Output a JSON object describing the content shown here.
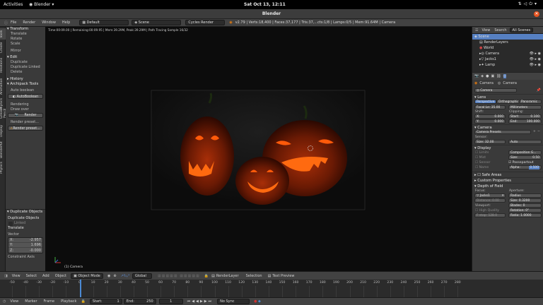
{
  "top_bar": {
    "activities": "Activities",
    "app_name": "Blender",
    "clock": "Sat Oct 13, 12:11"
  },
  "window": {
    "title": "Blender"
  },
  "info_header": {
    "menus": [
      "File",
      "Render",
      "Window",
      "Help"
    ],
    "layout": "Default",
    "scene": "Scene",
    "engine": "Cycles Render",
    "stats": "v2.79 | Verts:18,400 | Faces:37,177 | Tris:37,...cts:1/8 | Lamps:0/5 | Mem:91.64M | Camera"
  },
  "left_tabs": [
    "Tools",
    "Create",
    "Relations",
    "Animation",
    "Physics",
    "Grease Pencil",
    "Display",
    "BlenderKit",
    "Physics"
  ],
  "tool_shelf": {
    "transform_header": "Transform",
    "transform_items": [
      "Translate",
      "Rotate",
      "Scale"
    ],
    "mirror": "Mirror",
    "edit_header": "Edit",
    "edit_items": [
      "Duplicate",
      "Duplicate Linked",
      "Delete"
    ],
    "history_header": "History",
    "archipack_header": "Archipack Tools",
    "auto_boolean": "Auto boolean",
    "autoboolean_btn": "AutoBoolean",
    "rendering": "Rendering",
    "draw_over": "Draw over",
    "render_btn": "Render",
    "render_preset": "Render preset...",
    "render_preset_btn": "Render preset..."
  },
  "redo_panel": {
    "title": "Duplicate Objects",
    "op": "Duplicate Objects",
    "linked": "Linked",
    "translate": "Translate",
    "vector": "Vector",
    "x_label": "X:",
    "x_val": "-2.957",
    "y_label": "Y:",
    "y_val": "1.696",
    "z_label": "Z:",
    "z_val": "-0.000",
    "constraint": "Constraint Axis"
  },
  "viewport": {
    "render_status": "Time:00:09.00 | Remaining:00:09.95 | Mem:39.29M, Peak:39.29M | Path Tracing Sample 16/32",
    "object_label": "(1) Camera"
  },
  "outliner": {
    "tabs": [
      "View",
      "Search",
      "All Scenes"
    ],
    "items": [
      "Scene",
      "RenderLayers",
      "World",
      "Camera",
      "Jacks1",
      "Lamp"
    ]
  },
  "properties": {
    "object_name": "Camera",
    "data_name": "Camera",
    "data_field": "Camera",
    "lens_header": "Lens",
    "lens_tabs": [
      "Perspective",
      "Orthographic",
      "Panoramic"
    ],
    "focal_length": "Focal Le: 35.00",
    "lens_unit": "Millimeters",
    "shift": "Shift:",
    "shift_x_label": "X:",
    "shift_x": "0.000",
    "shift_y_label": "Y:",
    "shift_y": "0.000",
    "clipping": "Clipping:",
    "clip_start_label": "Start:",
    "clip_start": "0.100",
    "clip_end_label": "End:",
    "clip_end": "100.000",
    "camera_header": "Camera",
    "camera_presets": "Camera Presets",
    "sensor": "Sensor:",
    "sensor_size": "Size:    32.00",
    "sensor_fit": "Auto",
    "display_header": "Display",
    "limits": "Limits",
    "composition": "Composition G...",
    "mist": "Mist",
    "size_label": "Size:",
    "size_val": "0.50",
    "sensor_cb": "Sensor",
    "passepartout": "Passepartout",
    "name_cb": "Name",
    "alpha_label": "Alpha:",
    "alpha_val": "0.500",
    "safe_areas": "Safe Areas",
    "custom_props": "Custom Properties",
    "dof_header": "Depth of Field",
    "focus": "Focus:",
    "focus_obj": "Jacks1",
    "distance": "Distance: 0.00",
    "aperture": "Aperture:",
    "radius": "Radius",
    "ap_size": "Size:    0.3200",
    "viewport_label": "Viewport:",
    "blades": "Blades:      0",
    "high_quality": "High Quality",
    "rotation": "Rotation:     0°",
    "fstop": "F-stop:   128.0",
    "ratio": "Ratio:   1.0000"
  },
  "view3d_header": {
    "menus": [
      "View",
      "Select",
      "Add",
      "Object"
    ],
    "mode": "Object Mode",
    "pivot": "Global",
    "render_layer": "RenderLayer",
    "selection": "Selection",
    "text_preview": "Text Preview"
  },
  "timeline": {
    "ticks": [
      "-50",
      "-40",
      "-30",
      "-20",
      "-10",
      "0",
      "10",
      "20",
      "30",
      "40",
      "50",
      "60",
      "70",
      "80",
      "90",
      "100",
      "110",
      "120",
      "130",
      "140",
      "150",
      "160",
      "170",
      "180",
      "190",
      "200",
      "210",
      "220",
      "230",
      "240",
      "250",
      "260",
      "270",
      "280"
    ],
    "current_frame": "1"
  },
  "timeline_footer": {
    "menus": [
      "View",
      "Marker",
      "Frame",
      "Playback"
    ],
    "start": "Start:",
    "start_val": "1",
    "end": "End:",
    "end_val": "250",
    "frame": "1",
    "sync": "No Sync"
  }
}
